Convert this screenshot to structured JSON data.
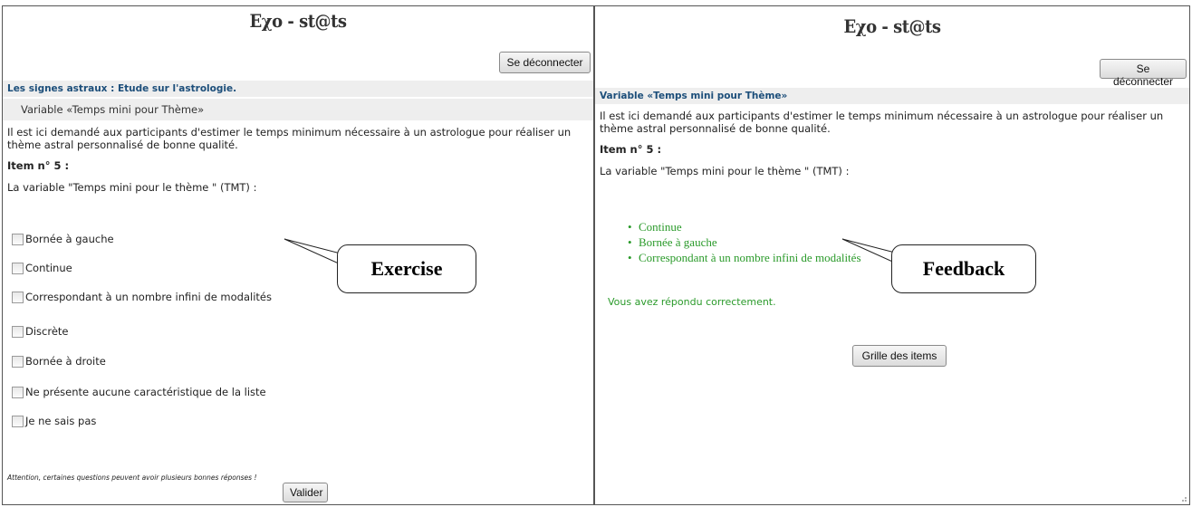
{
  "logo": "Εχο - st@ts",
  "left": {
    "logout_label": "Se déconnecter",
    "topic_heading": "Les signes astraux : Etude sur l'astrologie.",
    "variable_heading": "Variable «Temps mini pour Thème»",
    "question_text": "Il est ici demandé aux participants d'estimer le temps minimum nécessaire à un astrologue pour réaliser un thème astral personnalisé de bonne qualité.",
    "item_title": "Item n° 5 :",
    "prompt": "La variable \"Temps mini pour le thème \" (TMT) :",
    "options": [
      "Bornée à gauche",
      "Continue",
      "Correspondant à un nombre infini de modalités",
      "Discrète",
      "Bornée à droite",
      "Ne présente aucune caractéristique de la liste",
      "Je ne sais pas"
    ],
    "note": "Attention, certaines questions peuvent avoir plusieurs bonnes réponses !",
    "validate_label": "Valider"
  },
  "right": {
    "logout_label": "Se déconnecter",
    "variable_heading": "Variable «Temps mini pour Thème»",
    "question_text": "Il est ici demandé aux participants d'estimer le temps minimum nécessaire à un astrologue pour réaliser un thème astral personnalisé de bonne qualité.",
    "item_title": "Item n° 5 :",
    "prompt": "La variable \"Temps mini pour le thème \" (TMT) :",
    "answers": [
      "Continue",
      "Bornée à gauche",
      "Correspondant à un nombre infini de modalités"
    ],
    "success_message": "Vous avez répondu correctement.",
    "grid_label": "Grille des items"
  },
  "callouts": {
    "exercise": "Exercise",
    "feedback": "Feedback"
  },
  "colors": {
    "heading_blue": "#1c4e7a",
    "bar_grey": "#eeeeee",
    "success_green": "#2a9a2a"
  }
}
